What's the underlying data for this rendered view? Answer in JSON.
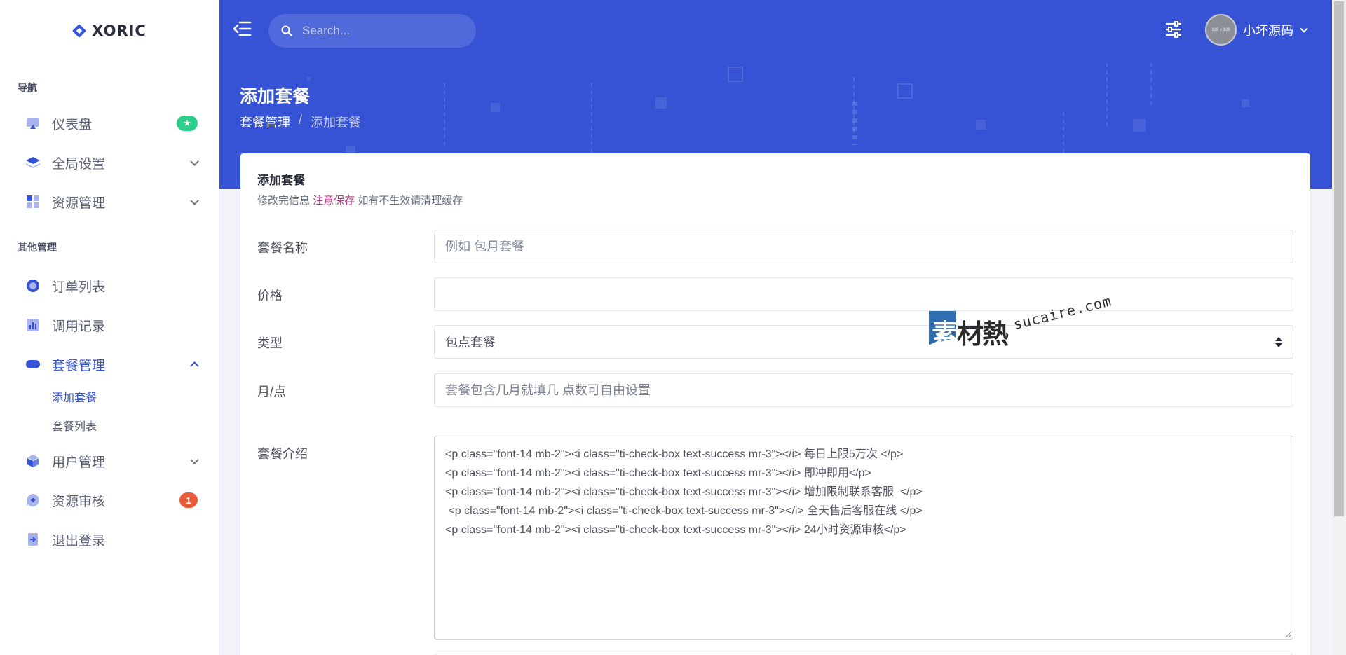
{
  "logo": {
    "name": "XORIC"
  },
  "sidebar": {
    "sections": [
      {
        "title": "导航"
      },
      {
        "title": "其他管理"
      }
    ],
    "items": [
      {
        "label": "仪表盘",
        "icon": "dashboard-icon",
        "badge": "★"
      },
      {
        "label": "全局设置",
        "icon": "layers-icon"
      },
      {
        "label": "资源管理",
        "icon": "grid-icon"
      },
      {
        "label": "订单列表",
        "icon": "circle-icon"
      },
      {
        "label": "调用记录",
        "icon": "bar-chart-icon"
      },
      {
        "label": "套餐管理",
        "icon": "pill-icon"
      },
      {
        "label": "用户管理",
        "icon": "cube-icon"
      },
      {
        "label": "资源审核",
        "icon": "chat-icon",
        "badge": "1"
      },
      {
        "label": "退出登录",
        "icon": "logout-icon"
      }
    ],
    "sub_items": [
      {
        "label": "添加套餐"
      },
      {
        "label": "套餐列表"
      }
    ]
  },
  "header": {
    "search_placeholder": "Search...",
    "user_name": "小坏源码",
    "avatar_text": "128 x 128"
  },
  "page": {
    "title": "添加套餐",
    "breadcrumb": [
      "套餐管理",
      "/",
      "添加套餐"
    ]
  },
  "card": {
    "title": "添加套餐",
    "subtitle_a": "修改完信息",
    "subtitle_highlight": "注意保存",
    "subtitle_b": "如有不生效请清理缓存"
  },
  "form": {
    "name_label": "套餐名称",
    "name_placeholder": "例如 包月套餐",
    "price_label": "价格",
    "price_value": "",
    "type_label": "类型",
    "type_selected": "包点套餐",
    "amount_label": "月/点",
    "amount_placeholder": "套餐包含几月就填几 点数可自由设置",
    "intro_label": "套餐介绍",
    "intro_value": "<p class=\"font-14 mb-2\"><i class=\"ti-check-box text-success mr-3\"></i> 每日上限5万次 </p>\n<p class=\"font-14 mb-2\"><i class=\"ti-check-box text-success mr-3\"></i> 即冲即用</p>\n<p class=\"font-14 mb-2\"><i class=\"ti-check-box text-success mr-3\"></i> 增加限制联系客服  </p>\n <p class=\"font-14 mb-2\"><i class=\"ti-check-box text-success mr-3\"></i> 全天售后客服在线 </p>\n<p class=\"font-14 mb-2\"><i class=\"ti-check-box text-success mr-3\"></i> 24小时资源审核</p>"
  },
  "watermark": {
    "first_char": "素",
    "rest": "材熱",
    "site": "sucaire.com"
  },
  "colors": {
    "primary": "#3653d6",
    "success": "#2ecf8c",
    "danger": "#ea5b3a",
    "highlight": "#b0367e"
  }
}
